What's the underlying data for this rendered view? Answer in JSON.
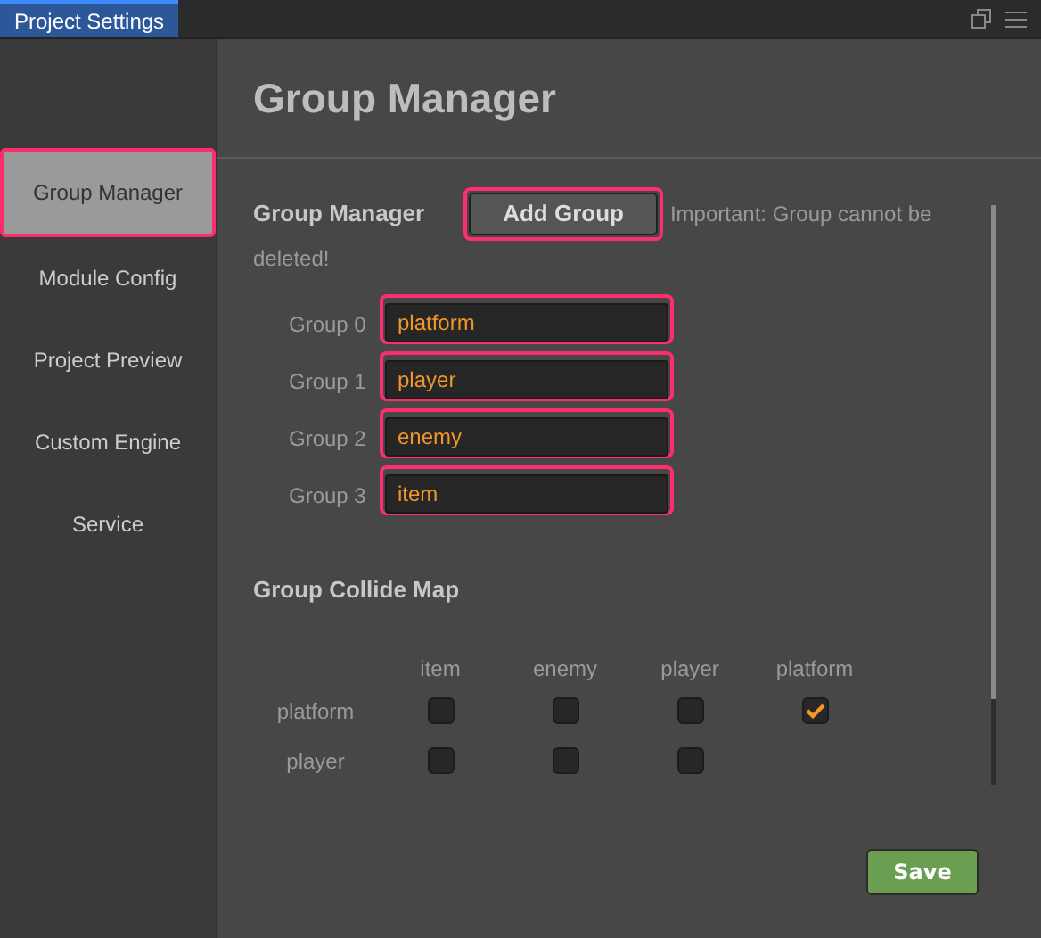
{
  "window": {
    "tab": "Project Settings"
  },
  "sidebar": {
    "items": [
      {
        "label": "Group Manager",
        "selected": true,
        "highlighted": true
      },
      {
        "label": "Module Config",
        "selected": false,
        "highlighted": false
      },
      {
        "label": "Project Preview",
        "selected": false,
        "highlighted": false
      },
      {
        "label": "Custom Engine",
        "selected": false,
        "highlighted": false
      },
      {
        "label": "Service",
        "selected": false,
        "highlighted": false
      }
    ]
  },
  "page_title": "Group Manager",
  "group_manager": {
    "title": "Group Manager",
    "add_button": {
      "label": "Add Group",
      "highlighted": true
    },
    "note_lines": [
      "Important: Group cannot be",
      "deleted!"
    ],
    "groups": [
      {
        "label": "Group 0",
        "value": "platform",
        "highlighted": true
      },
      {
        "label": "Group 1",
        "value": "player",
        "highlighted": true
      },
      {
        "label": "Group 2",
        "value": "enemy",
        "highlighted": true
      },
      {
        "label": "Group 3",
        "value": "item",
        "highlighted": true
      }
    ]
  },
  "collide_map": {
    "title": "Group Collide Map",
    "columns": [
      "item",
      "enemy",
      "player",
      "platform"
    ],
    "rows": [
      {
        "label": "platform",
        "cells": [
          {
            "checked": false
          },
          {
            "checked": false
          },
          {
            "checked": false
          },
          {
            "checked": true
          }
        ]
      },
      {
        "label": "player",
        "cells": [
          {
            "checked": false
          },
          {
            "checked": false
          },
          {
            "checked": false
          }
        ]
      }
    ]
  },
  "save_button": "Save"
}
